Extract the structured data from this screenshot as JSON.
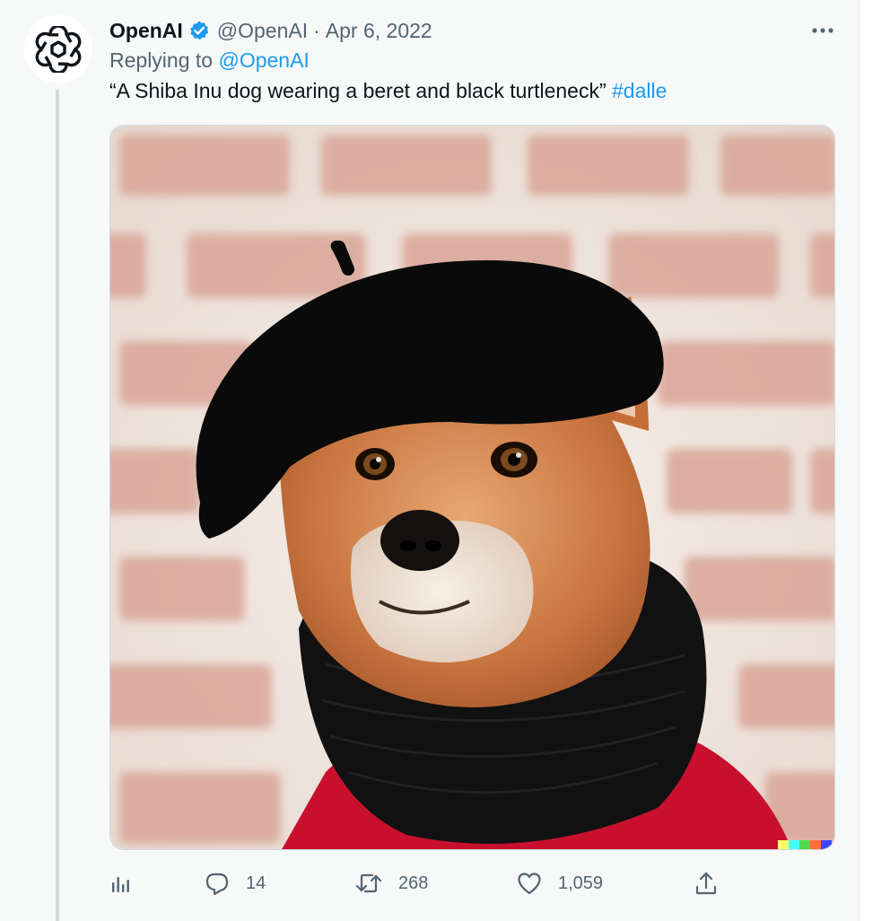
{
  "tweet": {
    "author_name": "OpenAI",
    "handle": "@OpenAI",
    "separator": "·",
    "date": "Apr 6, 2022",
    "replying_prefix": "Replying to",
    "replying_handle": "@OpenAI",
    "text": "“A Shiba Inu dog wearing a beret and black turtleneck”",
    "hashtag": "#dalle",
    "image_icon": "shiba-inu-photo",
    "colors": {
      "link": "#1d9bf0",
      "muted": "#536471",
      "verified": "#1d9bf0",
      "background": "#f7f9f9"
    }
  },
  "actions": {
    "analytics_icon": "analytics-icon",
    "reply_icon": "reply-icon",
    "reply_count": "14",
    "retweet_icon": "retweet-icon",
    "retweet_count": "268",
    "like_icon": "heart-icon",
    "like_count": "1,059",
    "share_icon": "share-icon"
  }
}
